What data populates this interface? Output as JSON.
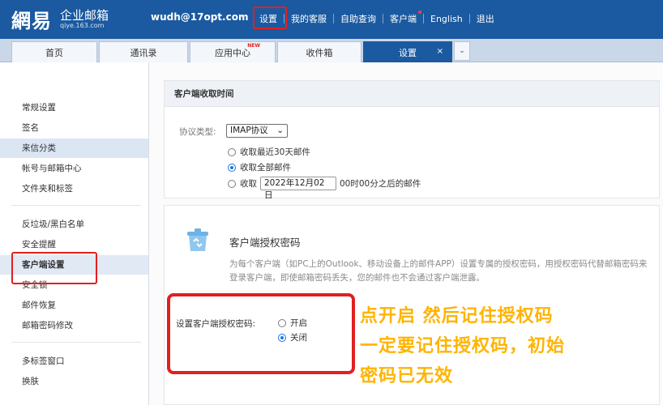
{
  "header": {
    "logo": {
      "brand": "網易",
      "product": "企业邮箱",
      "domain": "qiye.163.com"
    },
    "user_email": "wudh@17opt.com",
    "nav": [
      "设置",
      "我的客服",
      "自助查询",
      "客户端",
      "English",
      "退出"
    ]
  },
  "tabs": [
    {
      "label": "首页"
    },
    {
      "label": "通讯录"
    },
    {
      "label": "应用中心",
      "badge": "NEW"
    },
    {
      "label": "收件箱"
    },
    {
      "label": "设置",
      "close": "×"
    }
  ],
  "tab_more": "⌄",
  "sidebar": {
    "items": [
      "常规设置",
      "签名",
      "来信分类",
      "帐号与邮箱中心",
      "文件夹和标签",
      "反垃圾/黑白名单",
      "安全提醒",
      "客户端设置",
      "安全锁",
      "邮件恢复",
      "邮箱密码修改",
      "多标签窗口",
      "换肤"
    ]
  },
  "client_receive": {
    "title": "客户端收取时间",
    "protocol_label": "协议类型:",
    "protocol_value": "IMAP协议",
    "options": [
      "收取最近30天邮件",
      "收取全部邮件"
    ],
    "date_prefix": "收取",
    "date_value": "2022年12月02日",
    "date_suffix": "00时00分之后的邮件"
  },
  "auth": {
    "title": "客户端授权密码",
    "description": "为每个客户端（如PC上的Outlook、移动设备上的邮件APP）设置专属的授权密码，用授权密码代替邮箱密码来登录客户端，即使邮箱密码丢失，您的邮件也不会通过客户端泄露。",
    "setting_label": "设置客户端授权密码:",
    "options": [
      "开启",
      "关闭"
    ]
  },
  "annotation": {
    "line1": "点开启 然后记住授权码",
    "line2": "一定要记住授权码，初始",
    "line3": "密码已无效"
  },
  "colors": {
    "header_bg": "#1b5aa0",
    "highlight_red": "#e02020",
    "annotation": "#ffb400"
  },
  "icons": [
    "chevron-down-icon",
    "close-icon",
    "trash-can-icon"
  ]
}
